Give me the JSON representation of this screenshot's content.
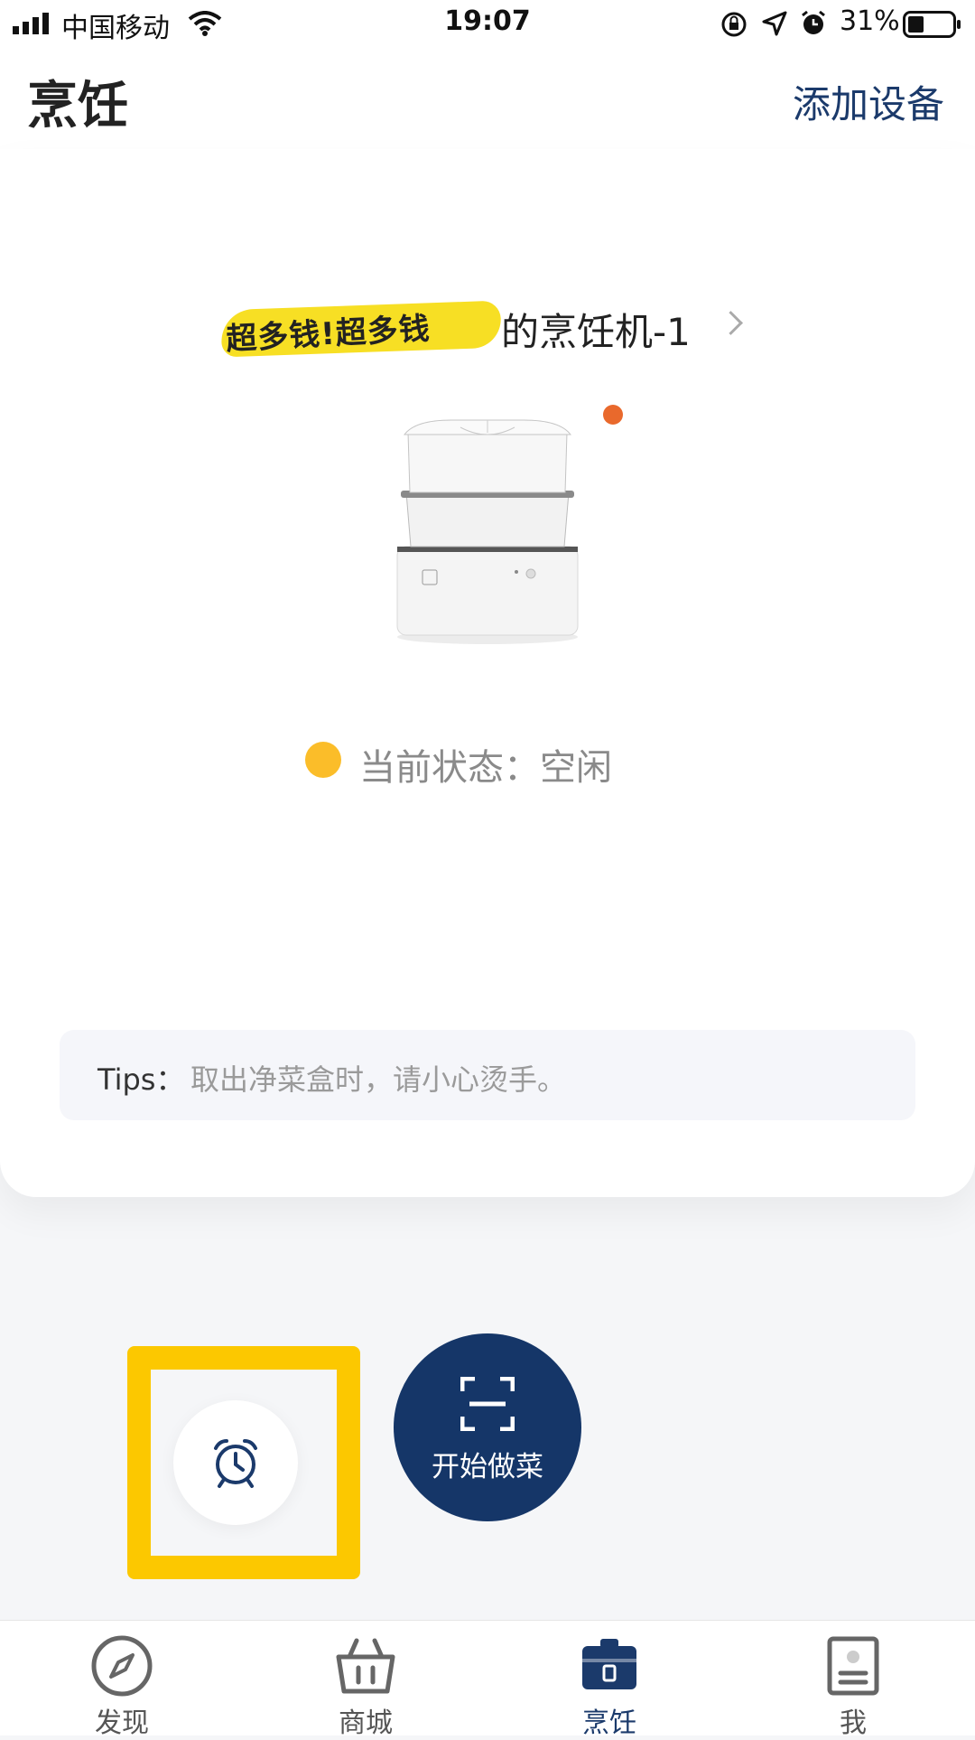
{
  "status_bar": {
    "carrier": "中国移动",
    "time": "19:07",
    "battery": "31%"
  },
  "header": {
    "title": "烹饪",
    "add_device": "添加设备"
  },
  "device": {
    "name_suffix": "的烹饪机-1",
    "name_redacted_scribble": "超多钱!超多钱",
    "status_label": "当前状态：空闲",
    "online_indicator_color": "#e9692c",
    "status_color": "#fbbd29"
  },
  "tips": {
    "label": "Tips：",
    "text": "取出净菜盒时，请小心烫手。"
  },
  "actions": {
    "start_cooking": "开始做菜",
    "timer_icon": "alarm-clock-icon",
    "highlight_color": "#fcc800",
    "primary_color": "#153668"
  },
  "tabs": [
    {
      "label": "发现",
      "icon": "compass-icon",
      "active": false
    },
    {
      "label": "商城",
      "icon": "basket-icon",
      "active": false
    },
    {
      "label": "烹饪",
      "icon": "cooker-icon",
      "active": true
    },
    {
      "label": "我",
      "icon": "profile-icon",
      "active": false
    }
  ]
}
